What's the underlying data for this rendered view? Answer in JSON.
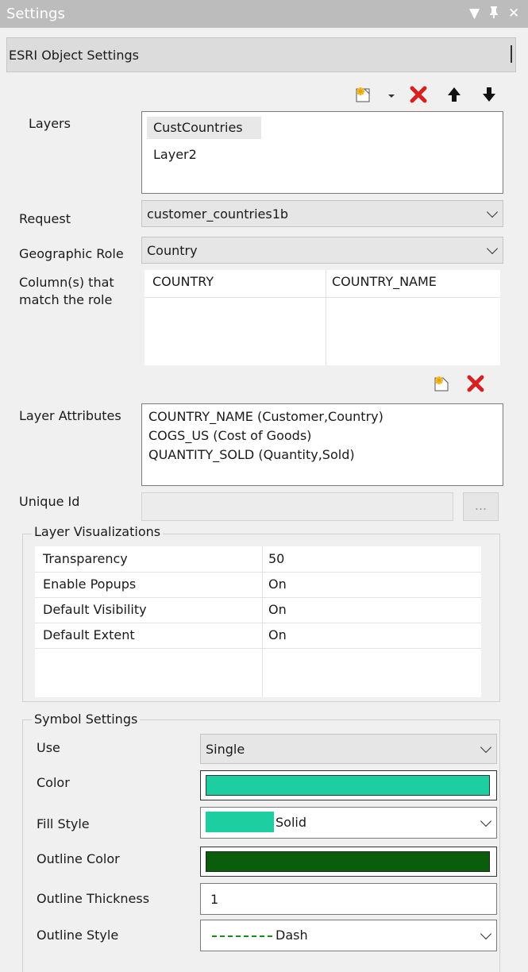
{
  "window": {
    "title": "Settings",
    "dropdown_glyph": "▼",
    "pin_glyph": "ᵽ",
    "close_glyph": "✕"
  },
  "object_header": {
    "title": "ESRI Object Settings"
  },
  "layers": {
    "label": "Layers",
    "items": [
      "CustCountries",
      "Layer2"
    ],
    "toolbar_icons": [
      "new-layer-icon",
      "dropdown-arrow-icon",
      "delete-icon",
      "move-up-icon",
      "move-down-icon"
    ]
  },
  "request": {
    "label": "Request",
    "value": "customer_countries1b"
  },
  "geographic_role": {
    "label": "Geographic Role",
    "value": "Country"
  },
  "columns_match": {
    "label_line1": "Column(s) that",
    "label_line2": "match the role",
    "columns": [
      "COUNTRY",
      "COUNTRY_NAME"
    ]
  },
  "layer_attributes": {
    "label": "Layer Attributes",
    "items": [
      "COUNTRY_NAME (Customer,Country)",
      "COGS_US (Cost of Goods)",
      "QUANTITY_SOLD (Quantity,Sold)"
    ]
  },
  "unique_id": {
    "label": "Unique Id",
    "value": "",
    "browse_label": "..."
  },
  "layer_visualizations": {
    "title": "Layer Visualizations",
    "rows": [
      {
        "name": "Transparency",
        "value": "50"
      },
      {
        "name": "Enable Popups",
        "value": "On"
      },
      {
        "name": "Default Visibility",
        "value": "On"
      },
      {
        "name": "Default Extent",
        "value": "On"
      }
    ]
  },
  "symbol_settings": {
    "title": "Symbol Settings",
    "use": {
      "label": "Use",
      "value": "Single"
    },
    "color": {
      "label": "Color",
      "swatch": "#1dcfa0"
    },
    "fill_style": {
      "label": "Fill Style",
      "value": "Solid",
      "swatch": "#1dcfa0"
    },
    "outline_color": {
      "label": "Outline Color",
      "swatch": "#0a5d0a"
    },
    "outline_thickness": {
      "label": "Outline Thickness",
      "value": "1"
    },
    "outline_style": {
      "label": "Outline Style",
      "value": "Dash",
      "line_color": "#1a8a1a"
    }
  }
}
